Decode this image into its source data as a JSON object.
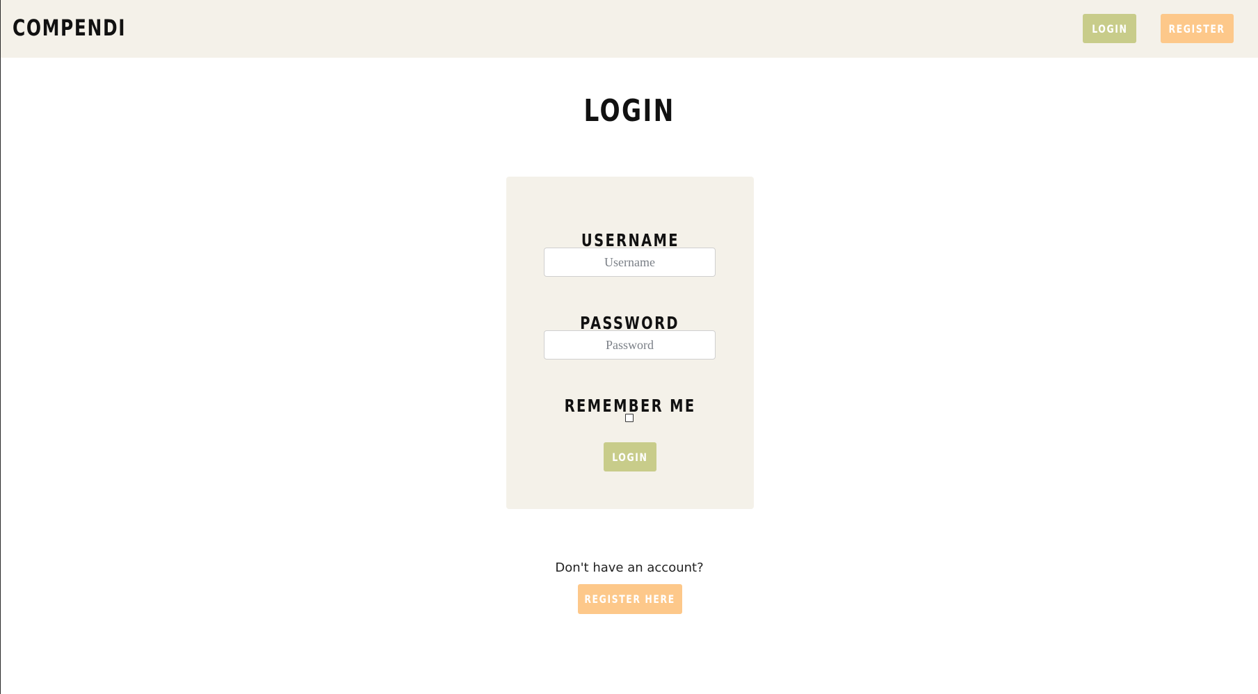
{
  "navbar": {
    "brand": "COMPENDI",
    "login_label": "LOGIN",
    "register_label": "REGISTER"
  },
  "page": {
    "title": "LOGIN"
  },
  "form": {
    "username_label": "USERNAME",
    "username_placeholder": "Username",
    "username_value": "",
    "password_label": "PASSWORD",
    "password_placeholder": "Password",
    "password_value": "",
    "remember_label": "REMEMBER ME",
    "remember_checked": false,
    "submit_label": "LOGIN"
  },
  "footer": {
    "prompt": "Don't have an account?",
    "register_label": "REGISTER HERE"
  },
  "colors": {
    "panel_bg": "#f4f1e9",
    "login_green": "#c8cc8a",
    "register_orange": "#fdc88a"
  }
}
